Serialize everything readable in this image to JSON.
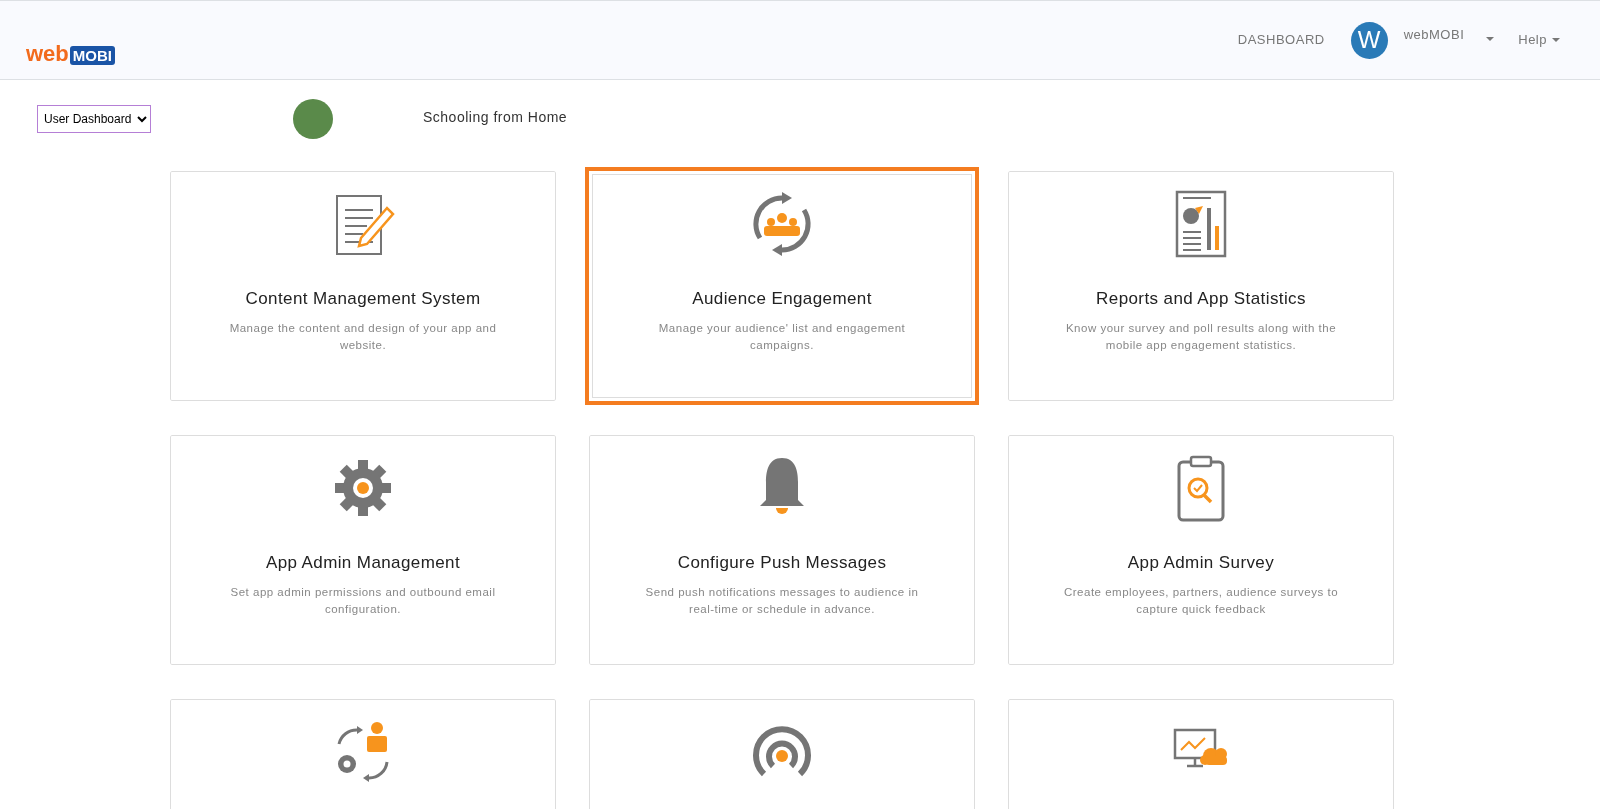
{
  "header": {
    "logo": {
      "part_1": "web",
      "part_2": "MOBI"
    },
    "nav": {
      "dashboard": "DASHBOARD",
      "avatar_letter": "W",
      "user": "webMOBI",
      "help": "Help"
    }
  },
  "toolbar": {
    "select_value": "User Dashboard",
    "app_name": "Schooling from Home"
  },
  "cards": [
    {
      "kind": "document",
      "title": "Content Management System",
      "description": "Manage the content and design of your app and website.",
      "selected": false
    },
    {
      "kind": "audience",
      "title": "Audience Engagement",
      "description": "Manage your audience' list and engagement campaigns.",
      "selected": true
    },
    {
      "kind": "report",
      "title": "Reports and App Statistics",
      "description": "Know your survey and poll results along with the mobile app engagement statistics.",
      "selected": false
    },
    {
      "kind": "gear",
      "title": "App Admin Management",
      "description": "Set app admin permissions and outbound email configuration.",
      "selected": false
    },
    {
      "kind": "bell",
      "title": "Configure Push Messages",
      "description": "Send push notifications messages to audience in real-time or schedule in advance.",
      "selected": false
    },
    {
      "kind": "clipboard",
      "title": "App Admin Survey",
      "description": "Create employees, partners, audience surveys to capture quick feedback",
      "selected": false
    },
    {
      "kind": "person-cycle",
      "selected": false
    },
    {
      "kind": "beacon",
      "selected": false
    },
    {
      "kind": "monitor-cloud",
      "selected": false
    }
  ]
}
